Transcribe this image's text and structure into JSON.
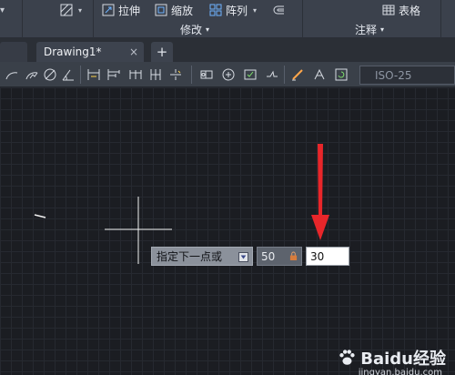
{
  "ribbon": {
    "items": [
      {
        "label": "拉伸",
        "icon": "stretch-icon"
      },
      {
        "label": "缩放",
        "icon": "scale-icon"
      },
      {
        "label": "阵列",
        "icon": "array-icon"
      },
      {
        "label": "表格",
        "icon": "table-icon"
      }
    ],
    "panels": [
      {
        "label": "修改",
        "icon": "chevron-down-icon"
      },
      {
        "label": "注释",
        "icon": "chevron-down-icon"
      }
    ]
  },
  "tabs": {
    "active": "Drawing1*",
    "close": "×",
    "new": "+"
  },
  "toolstrip": {
    "dim_style": "ISO-25"
  },
  "dynamic_input": {
    "prompt": "指定下一点或",
    "length": "50",
    "angle": "30"
  },
  "watermark": {
    "brand": "Baidu经验",
    "url": "jingyan.baidu.com"
  },
  "colors": {
    "arrow": "#e8262a",
    "canvas": "#1b1d22",
    "ribbon": "#3b414c"
  }
}
